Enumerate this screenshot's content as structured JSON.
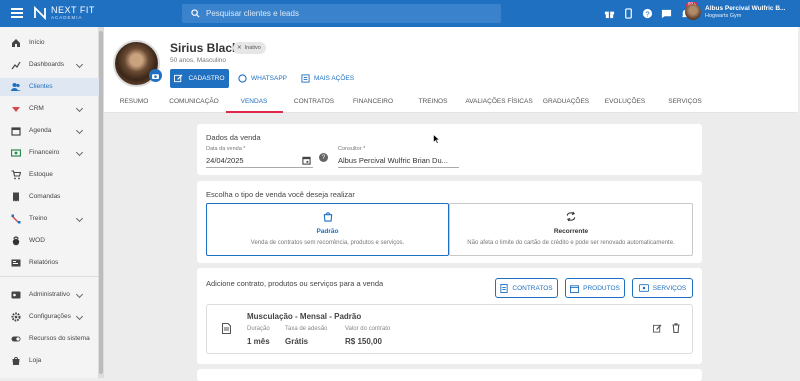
{
  "topbar": {
    "brand_line1": "NEXT FIT",
    "brand_line2": "ACADEMIA",
    "search_placeholder": "Pesquisar clientes e leads",
    "notification_count": "99+",
    "user_name": "Albus Percival Wulfric B...",
    "user_org": "Hogwarts Gym",
    "icons": [
      "gift-icon",
      "mobile-icon",
      "help-icon",
      "chat-icon",
      "bell-icon"
    ],
    "color": "#1f70c1"
  },
  "sidebar": {
    "items": [
      {
        "label": "Início",
        "icon": "home-icon"
      },
      {
        "label": "Dashboards",
        "icon": "chart-icon",
        "expand": true
      },
      {
        "label": "Clientes",
        "icon": "users-icon",
        "active": true
      },
      {
        "label": "CRM",
        "icon": "crm-icon",
        "expand": true
      },
      {
        "label": "Agenda",
        "icon": "calendar-icon",
        "expand": true
      },
      {
        "label": "Financeiro",
        "icon": "money-icon",
        "expand": true
      },
      {
        "label": "Estoque",
        "icon": "cart-icon"
      },
      {
        "label": "Comandas",
        "icon": "receipt-icon"
      },
      {
        "label": "Treino",
        "icon": "dumbbell-icon",
        "expand": true
      },
      {
        "label": "WOD",
        "icon": "kettlebell-icon"
      },
      {
        "label": "Relatórios",
        "icon": "report-icon"
      },
      {
        "label": "Administrativo",
        "icon": "admin-icon",
        "expand": true
      },
      {
        "label": "Configurações",
        "icon": "gear-icon",
        "expand": true
      },
      {
        "label": "Recursos do sistema",
        "icon": "toggle-icon"
      },
      {
        "label": "Loja",
        "icon": "shop-icon"
      }
    ]
  },
  "profile": {
    "name": "Sirius Black",
    "status": "Inativo",
    "info": "50 anos, Masculino",
    "btn_cadastro": "CADASTRO",
    "btn_whatsapp": "WHATSAPP",
    "btn_more": "MAIS AÇÕES"
  },
  "tabs": [
    "RESUMO",
    "COMUNICAÇÃO",
    "VENDAS",
    "CONTRATOS",
    "FINANCEIRO",
    "TREINOS",
    "AVALIAÇÕES FÍSICAS",
    "GRADUAÇÕES",
    "EVOLUÇÕES",
    "SERVIÇOS"
  ],
  "active_tab": "VENDAS",
  "sale": {
    "title": "Dados da venda",
    "date_label": "Data da venda *",
    "date_value": "24/04/2025",
    "consultant_label": "Consultor *",
    "consultant_value": "Albus Percival Wulfric Brian Du..."
  },
  "type": {
    "title": "Escolha o tipo de venda você deseja realizar",
    "options": [
      {
        "title": "Padrão",
        "desc": "Venda de contratos sem recorrência, produtos e serviços.",
        "selected": true,
        "icon": "bag-icon"
      },
      {
        "title": "Recorrente",
        "desc": "Não afeta o limite do cartão de crédito e pode ser renovado automaticamente.",
        "selected": false,
        "icon": "repeat-icon"
      }
    ]
  },
  "add": {
    "title": "Adicione contrato, produtos ou serviços para a venda",
    "buttons": [
      "CONTRATOS",
      "PRODUTOS",
      "SERVIÇOS"
    ]
  },
  "item": {
    "title": "Musculação - Mensal - Padrão",
    "duration_label": "Duração",
    "duration_value": "1 mês",
    "fee_label": "Taxa de adesão",
    "fee_value": "Grátis",
    "contract_label": "Valor do contrato",
    "contract_value": "R$ 150,00"
  }
}
